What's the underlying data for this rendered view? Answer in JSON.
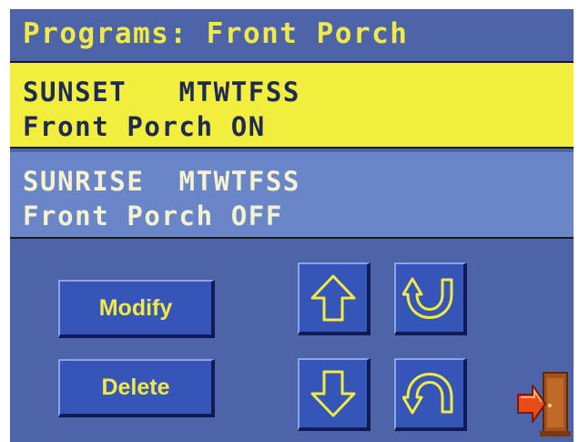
{
  "header": {
    "title": "Programs: Front Porch"
  },
  "programs": [
    {
      "trigger": "SUNSET",
      "days": "MTWTFSS",
      "action": "Front Porch ON",
      "selected": true
    },
    {
      "trigger": "SUNRISE",
      "days": "MTWTFSS",
      "action": "Front Porch OFF",
      "selected": false
    }
  ],
  "buttons": {
    "modify": "Modify",
    "delete": "Delete"
  },
  "icons": {
    "up": "arrow-up-icon",
    "top": "scroll-top-icon",
    "down": "arrow-down-icon",
    "bottom": "scroll-bottom-icon",
    "exit": "exit-door-icon"
  },
  "colors": {
    "panel": "#4e64a9",
    "accent_yellow": "#f0ea47",
    "selected_row": "#f2ee3e",
    "unselected_row": "#6a86c8",
    "button": "#3655b8"
  }
}
